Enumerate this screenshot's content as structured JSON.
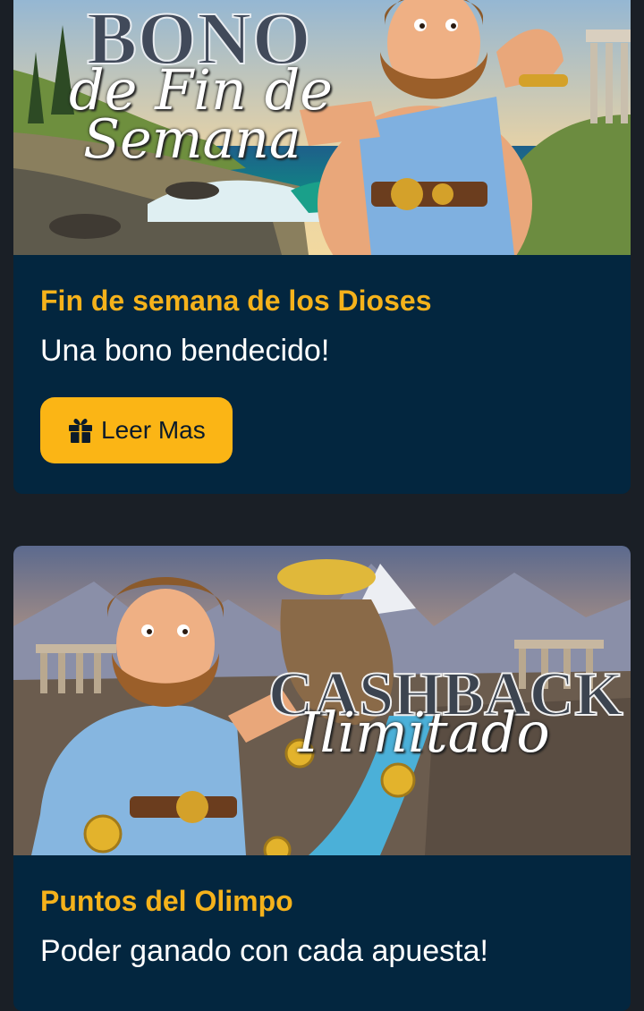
{
  "cards": [
    {
      "banner_title": "BONO",
      "banner_script_line1": "de Fin de",
      "banner_script_line2": "Semana",
      "title": "Fin de semana de los Dioses",
      "subtitle": "Una bono bendecido!",
      "button_label": "Leer Mas",
      "button_icon": "gift-icon"
    },
    {
      "banner_title": "CASHBACK",
      "banner_script": "Ilimitado",
      "title": "Puntos del Olimpo",
      "subtitle": "Poder ganado con cada apuesta!"
    }
  ],
  "colors": {
    "page_bg": "#1a1f26",
    "card_bg": "#03263f",
    "title": "#f5b21b",
    "button": "#fbb515"
  }
}
